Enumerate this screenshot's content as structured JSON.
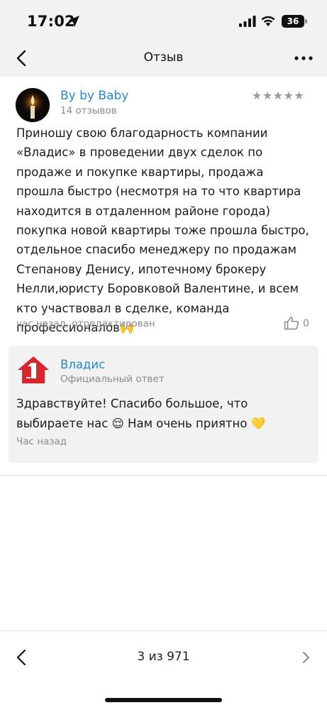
{
  "status_bar": {
    "time": "17:02",
    "battery": "36",
    "icons": [
      "location-arrow-icon",
      "cellular-signal-icon",
      "wifi-icon",
      "battery-icon"
    ]
  },
  "nav": {
    "title": "Отзыв",
    "back_icon": "chevron-left-icon",
    "more_icon": "more-dots-icon"
  },
  "review": {
    "author": "By by Baby",
    "review_count": "14 отзывов",
    "stars": "★★★★★",
    "rating": 5,
    "text": "Приношу свою благодарность компании «Владис» в проведении двух сделок по продаже и покупке квартиры, продажа прошла быстро (несмотря на то что квартира находится в отдаленном районе города) покупка новой квартиры тоже прошла быстро, отдельное спасибо менеджеру по продажам Степанову Денису, ипотечному брокеру Нелли,юристу Боровковой Валентине, и всем кто участвовал в сделке, команда профессионалов🙌",
    "meta": "час назад, отредактирован",
    "likes": "0"
  },
  "reply": {
    "author": "Владис",
    "badge": "Официальный ответ",
    "text": "Здравствуйте! Спасибо большое, что выбираете нас 😌 Нам очень приятно 💛",
    "time": "Час назад"
  },
  "pager": {
    "label": "3 из 971"
  },
  "colors": {
    "link": "#2b87c8",
    "muted": "#8a8a8a",
    "logo_red": "#d8262c",
    "panel_bg": "#f2f2f2"
  }
}
